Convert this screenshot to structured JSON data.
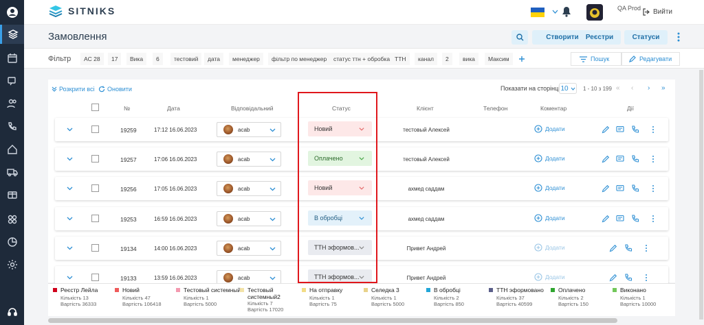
{
  "app": {
    "name": "SITNIKS",
    "user": "QA Prod",
    "logout": "Вийти"
  },
  "page_title": "Замовлення",
  "header_buttons": {
    "create": "Створити",
    "registers": "Реєстри",
    "statuses": "Статуси"
  },
  "filter": {
    "label": "Фільтр",
    "chips": [
      "AC 28",
      "17",
      "Вика",
      "6",
      "тестовий",
      "дата",
      "менеджер",
      "фільтр по менеджер",
      "статус ттн + обробка",
      "ТТН",
      "канал",
      "2",
      "вика",
      "Максим"
    ],
    "search": "Пошук",
    "edit": "Редагувати"
  },
  "toolbar": {
    "expand_all": "Розкрити всі",
    "refresh": "Оновити",
    "per_page_label": "Показати на сторінці",
    "per_page": "10",
    "page_range": "1 - 10 з 199"
  },
  "columns": {
    "num": "№",
    "date": "Дата",
    "responsible": "Відповідальний",
    "status": "Статус",
    "client": "Клієнт",
    "phone": "Телефон",
    "comment": "Коментар",
    "actions": "Дії"
  },
  "rows": [
    {
      "id": "19259",
      "date": "17:12 16.06.2023",
      "user": "acab",
      "status": "Новий",
      "client": "тестовый Алексей",
      "comment": "Додати"
    },
    {
      "id": "19257",
      "date": "17:06 16.06.2023",
      "user": "acab",
      "status": "Оплачено",
      "client": "тестовый Алексей",
      "comment": "Додати"
    },
    {
      "id": "19256",
      "date": "17:05 16.06.2023",
      "user": "acab",
      "status": "Новий",
      "client": "ахмед саддам",
      "comment": "Додати"
    },
    {
      "id": "19253",
      "date": "16:59 16.06.2023",
      "user": "acab",
      "status": "В обробці",
      "client": "ахмед саддам",
      "comment": "Додати"
    },
    {
      "id": "19134",
      "date": "14:00 16.06.2023",
      "user": "acab",
      "status": "ТТН эформов...",
      "client": "Привет Андрей",
      "comment": "Додати"
    },
    {
      "id": "19133",
      "date": "13:59 16.06.2023",
      "user": "acab",
      "status": "ТТН эформов...",
      "client": "Привет Андрей",
      "comment": "Додати"
    }
  ],
  "status_colors": {
    "new": "#fde8e8",
    "paid": "#e2f5e0",
    "processing": "#e3f1fa",
    "ttn": "#e9ebf0"
  },
  "legend": [
    {
      "name": "Реєстр Лейла",
      "count": "Кількість 13",
      "value": "Вартість 36333",
      "color": "#d0021b"
    },
    {
      "name": "Новий",
      "count": "Кількість 47",
      "value": "Вартість 106418",
      "color": "#ef5a5a"
    },
    {
      "name": "Тестовый системный",
      "count": "Кількість 1",
      "value": "Вартість 5000",
      "color": "#f49ab0"
    },
    {
      "name": "Тестовый системный2",
      "count": "Кількість 7",
      "value": "Вартість 17020",
      "color": "#f3e3a8"
    },
    {
      "name": "На отправку",
      "count": "Кількість 1",
      "value": "Вартість 75",
      "color": "#f2dc86"
    },
    {
      "name": "Селедка 3",
      "count": "Кількість 1",
      "value": "Вартість 5000",
      "color": "#e8d28a"
    },
    {
      "name": "В обробці",
      "count": "Кількість 2",
      "value": "Вартість 850",
      "color": "#22a6d8"
    },
    {
      "name": "ТТН эформовано",
      "count": "Кількість 37",
      "value": "Вартість 40599",
      "color": "#5b5f8a"
    },
    {
      "name": "Оплачено",
      "count": "Кількість 2",
      "value": "Вартість 150",
      "color": "#2fa52f"
    },
    {
      "name": "Виконано",
      "count": "Кількість 1",
      "value": "Вартість 10000",
      "color": "#72c75a"
    }
  ]
}
